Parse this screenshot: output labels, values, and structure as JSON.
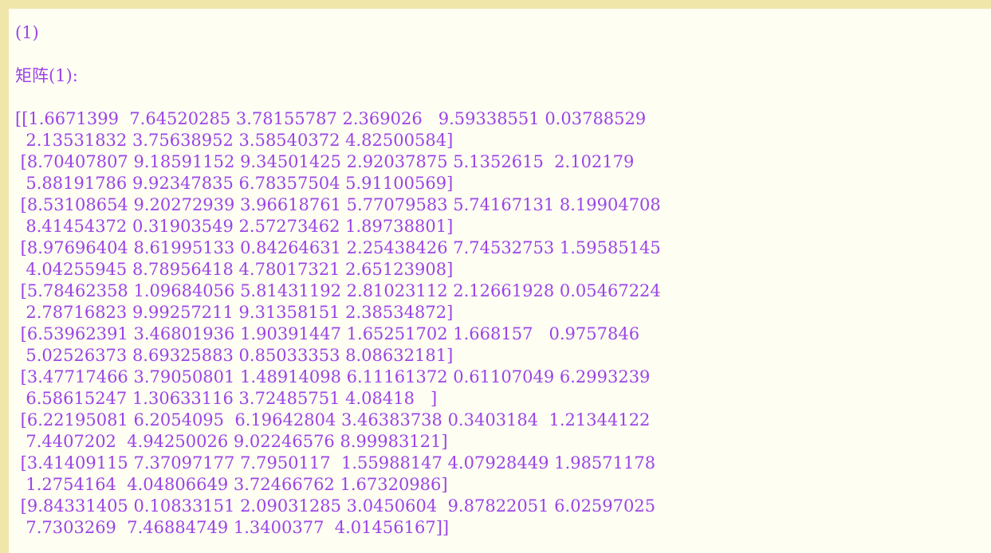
{
  "output": {
    "line1": "(1)",
    "line2": "矩阵(1):",
    "matrix_lines": [
      "[[1.6671399  7.64520285 3.78155787 2.369026   9.59338551 0.03788529",
      "  2.13531832 3.75638952 3.58540372 4.82500584]",
      " [8.70407807 9.18591152 9.34501425 2.92037875 5.1352615  2.102179",
      "  5.88191786 9.92347835 6.78357504 5.91100569]",
      " [8.53108654 9.20272939 3.96618761 5.77079583 5.74167131 8.19904708",
      "  8.41454372 0.31903549 2.57273462 1.89738801]",
      " [8.97696404 8.61995133 0.84264631 2.25438426 7.74532753 1.59585145",
      "  4.04255945 8.78956418 4.78017321 2.65123908]",
      " [5.78462358 1.09684056 5.81431192 2.81023112 2.12661928 0.05467224",
      "  2.78716823 9.99257211 9.31358151 2.38534872]",
      " [6.53962391 3.46801936 1.90391447 1.65251702 1.668157   0.9757846",
      "  5.02526373 8.69325883 0.85033353 8.08632181]",
      " [3.47717466 3.79050801 1.48914098 6.11161372 0.61107049 6.2993239",
      "  6.58615247 1.30633116 3.72485751 4.08418   ]",
      " [6.22195081 6.2054095  6.19642804 3.46383738 0.3403184  1.21344122",
      "  7.4407202  4.94250026 9.02246576 8.99983121]",
      " [3.41409115 7.37097177 7.7950117  1.55988147 4.07928449 1.98571178",
      "  1.2754164  4.04806649 3.72466762 1.67320986]",
      " [9.84331405 0.10833151 2.09031285 3.0450604  9.87822051 6.02597025",
      "  7.7303269  7.46884749 1.3400377  4.01456167]]"
    ]
  },
  "colors": {
    "page_background": "#f0e6aa",
    "panel_background": "#fefef2",
    "text": "#9b44e8"
  }
}
